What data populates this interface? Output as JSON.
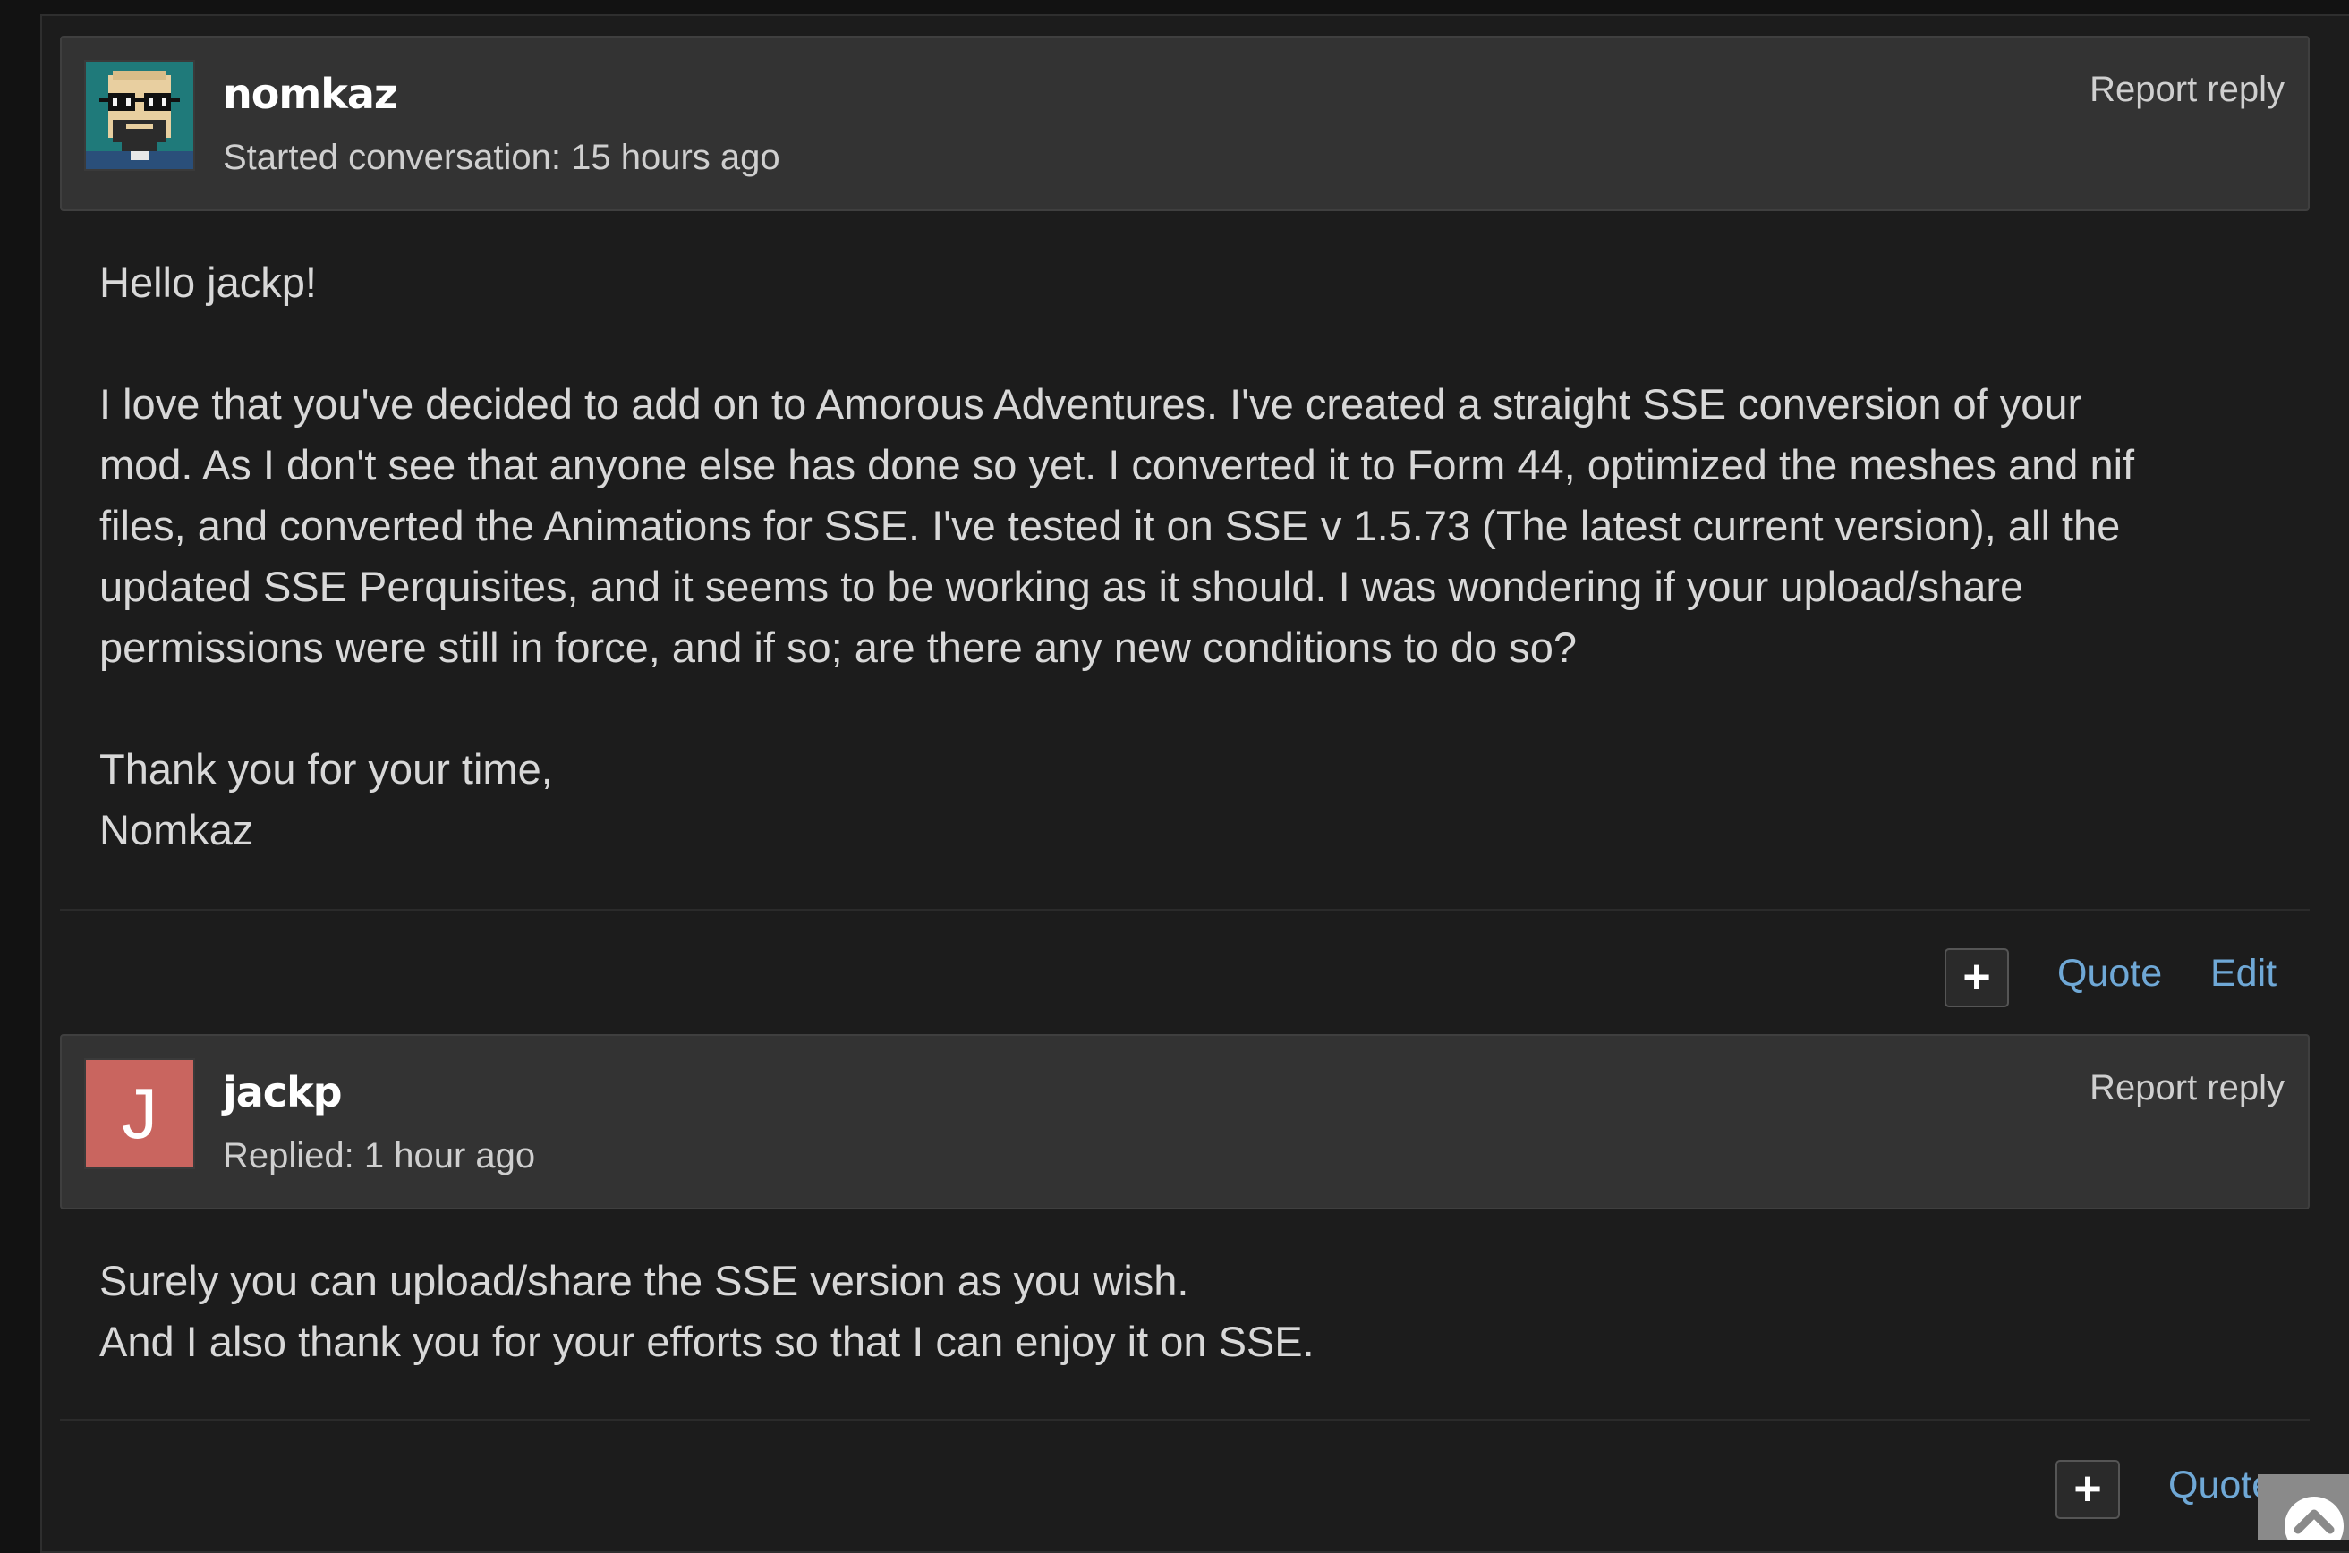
{
  "posts": [
    {
      "username": "nomkaz",
      "meta": "Started conversation: 15 hours ago",
      "report": "Report reply",
      "body": {
        "greeting": "Hello jackp!",
        "lines": [
          "I love that you've decided to add on to Amorous Adventures. I've created a straight SSE conversion of your",
          "mod. As I don't see that anyone else has done so yet. I converted it to Form 44, optimized the meshes and nif",
          "files, and converted the Animations for SSE. I've tested it on SSE v 1.5.73 (The latest current version), all the",
          "updated SSE Perquisites, and it seems to be working as it should. I was wondering if your upload/share",
          "permissions were still in force, and if so; are there any new conditions to do so?"
        ],
        "closing": "Thank you for your time,",
        "signature": "Nomkaz"
      },
      "actions": {
        "plus": "+",
        "quote": "Quote",
        "edit": "Edit"
      }
    },
    {
      "username": "jackp",
      "avatar_letter": "J",
      "meta": "Replied: 1 hour ago",
      "report": "Report reply",
      "body": {
        "lines": [
          "Surely you can upload/share the SSE version as you wish.",
          "And I also thank you for your efforts so that I can enjoy it on SSE."
        ]
      },
      "actions": {
        "plus": "+",
        "quote": "Quote"
      }
    }
  ],
  "colors": {
    "page_bg": "#121212",
    "panel_bg": "#1c1c1c",
    "header_bg": "#333333",
    "link": "#6fa8d6",
    "avatar_j": "#c9655f"
  },
  "icons": {
    "scroll_top": "chevron-up-icon",
    "plus": "plus-icon"
  }
}
